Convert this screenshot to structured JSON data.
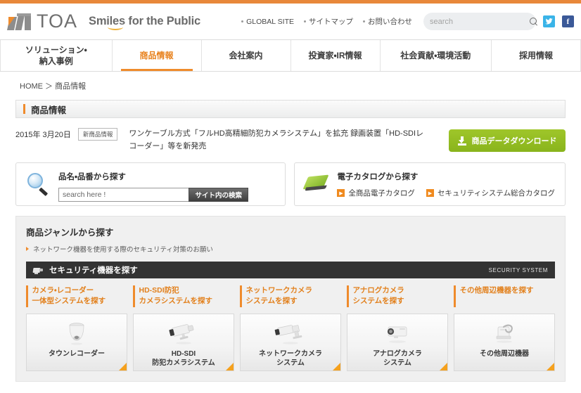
{
  "header": {
    "logo_text": "TOA",
    "tagline": "Smiles for the Public",
    "links": [
      {
        "label": "GLOBAL SITE"
      },
      {
        "label": "サイトマップ"
      },
      {
        "label": "お問い合わせ"
      }
    ],
    "search_placeholder": "search",
    "search_value": "",
    "social": [
      {
        "name": "twitter",
        "glyph": "ᴠ"
      },
      {
        "name": "facebook",
        "glyph": "f"
      }
    ]
  },
  "nav": [
    {
      "label": "ソリューション・\n納入事例",
      "active": false
    },
    {
      "label": "商品情報",
      "active": true
    },
    {
      "label": "会社案内",
      "active": false
    },
    {
      "label": "投資家・IR情報",
      "active": false
    },
    {
      "label": "社会貢献・環境活動",
      "active": false
    },
    {
      "label": "採用情報",
      "active": false
    }
  ],
  "breadcrumb": "HOME ＞ 商品情報",
  "page_title": "商品情報",
  "news": {
    "date": "2015年 3月20日",
    "badge": "新商品情報",
    "text": "ワンケーブル方式「フルHD高精細防犯カメラシステム」を拡充 録画装置「HD-SDIレコーダー」等を新発売",
    "download_label": "商品データダウンロード"
  },
  "panel_left": {
    "title": "品名・品番から探す",
    "input_placeholder": "search here !",
    "input_value": "",
    "button_label": "サイト内の検索"
  },
  "panel_right": {
    "title": "電子カタログから探す",
    "links": [
      {
        "label": "全商品電子カタログ"
      },
      {
        "label": "セキュリティシステム総合カタログ"
      }
    ]
  },
  "genre": {
    "title": "商品ジャンルから探す",
    "note": "ネットワーク機器を使用する際のセキュリティ対策のお願い",
    "section_bar": {
      "label": "セキュリティ機器を探す",
      "right_label": "SECURITY SYSTEM"
    },
    "category_heads": [
      "カメラ・レコーダー\n一体型システムを探す",
      "HD-SDI防犯\nカメラシステムを探す",
      "ネットワークカメラ\nシステムを探す",
      "アナログカメラ\nシステムを探す",
      "その他周辺機器を探す"
    ],
    "cards": [
      {
        "caption": "タウンレコーダー",
        "icon": "dome-camera-icon"
      },
      {
        "caption": "HD-SDI\n防犯カメラシステム",
        "icon": "bullet-camera-icon"
      },
      {
        "caption": "ネットワークカメラ\nシステム",
        "icon": "network-camera-icon"
      },
      {
        "caption": "アナログカメラ\nシステム",
        "icon": "box-camera-icon"
      },
      {
        "caption": "その他周辺機器",
        "icon": "peripheral-device-icon"
      }
    ]
  },
  "colors": {
    "accent_orange": "#ef8b2c",
    "green_button": "#8fb825",
    "dark_bar": "#333333"
  }
}
